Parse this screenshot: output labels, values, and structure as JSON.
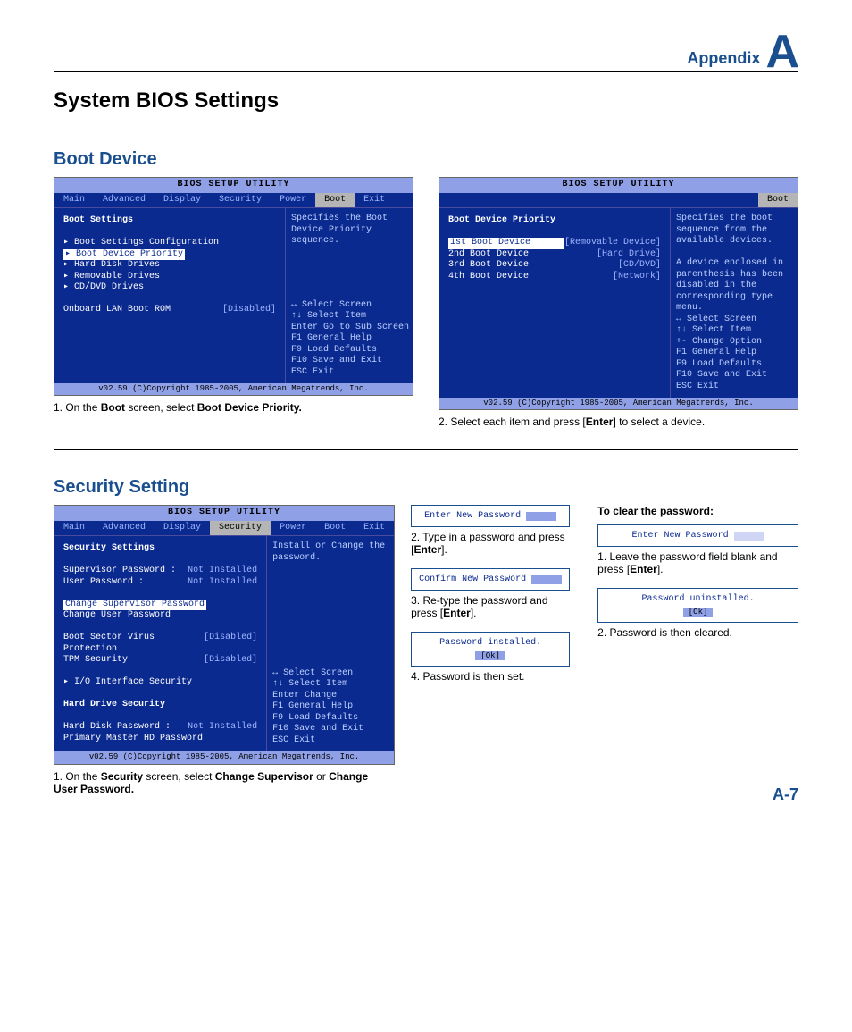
{
  "header": {
    "appendix": "Appendix",
    "letter": "A"
  },
  "title": "System BIOS Settings",
  "page_num": "A-7",
  "bios_common": {
    "util_title": "BIOS SETUP UTILITY",
    "footer": "v02.59 (C)Copyright 1985-2005, American Megatrends, Inc.",
    "tabs": [
      "Main",
      "Advanced",
      "Display",
      "Security",
      "Power",
      "Boot",
      "Exit"
    ],
    "keys_full": [
      "↔    Select Screen",
      "↑↓   Select Item",
      "Enter Go to Sub Screen",
      "F1   General Help",
      "F9   Load Defaults",
      "F10  Save and Exit",
      "ESC  Exit"
    ],
    "keys_sel": [
      "↔    Select Screen",
      "↑↓   Select Item",
      "+-   Change Option",
      "F1   General Help",
      "F9   Load Defaults",
      "F10  Save and Exit",
      "ESC  Exit"
    ],
    "keys_sec": [
      "↔    Select Screen",
      "↑↓   Select Item",
      "Enter Change",
      "F1   General Help",
      "F9   Load Defaults",
      "F10  Save and Exit",
      "ESC  Exit"
    ]
  },
  "boot": {
    "heading": "Boot Device",
    "s1": {
      "help": "Specifies the Boot Device Priority sequence.",
      "sect": "Boot Settings",
      "rows": [
        "▸ Boot Settings Configuration",
        "",
        "▸ Boot Device Priority",
        "▸ Hard Disk Drives",
        "▸ Removable Drives",
        "▸ CD/DVD Drives"
      ],
      "opt_label": "Onboard LAN Boot ROM",
      "opt_val": "[Disabled]",
      "selected_tab": "Boot",
      "caption_pre": "1. On the ",
      "caption_b1": "Boot",
      "caption_mid": " screen, select ",
      "caption_b2": "Boot Device Priority."
    },
    "s2": {
      "help": "Specifies the boot sequence from the available devices.",
      "help2": "A device enclosed in parenthesis has been disabled in the corresponding type menu.",
      "sect": "Boot Device Priority",
      "rows": [
        {
          "l": "1st Boot Device",
          "v": "[Removable Device]"
        },
        {
          "l": "2nd Boot Device",
          "v": "[Hard Drive]"
        },
        {
          "l": "3rd Boot Device",
          "v": "[CD/DVD]"
        },
        {
          "l": "4th Boot Device",
          "v": "[Network]"
        }
      ],
      "selected_tab": "Boot",
      "caption_pre": "2. Select each item and press [",
      "caption_b": "Enter",
      "caption_post": "] to select a device."
    }
  },
  "security": {
    "heading": "Security Setting",
    "bios": {
      "help": "Install or Change the password.",
      "sect": "Security Settings",
      "sup_lbl": "Supervisor Password :",
      "sup_val": "Not Installed",
      "usr_lbl": "User Password      :",
      "usr_val": "Not Installed",
      "c1": "Change Supervisor Password",
      "c2": "Change User Password",
      "bsv_lbl": "Boot Sector Virus Protection",
      "bsv_val": "[Disabled]",
      "tpm_lbl": "TPM Security",
      "tpm_val": "[Disabled]",
      "io": "▸ I/O Interface Security",
      "hd_sect": "Hard Drive Security",
      "hdp_lbl": "Hard Disk Password  :",
      "hdp_val": "Not Installed",
      "pmp": "Primary Master HD Password",
      "selected_tab": "Security",
      "cap_pre": "1. On the ",
      "cap_b1": "Security",
      "cap_mid": " screen, select ",
      "cap_b2": "Change Supervisor",
      "cap_or": " or ",
      "cap_b3": "Change User Password."
    },
    "mid": {
      "p1": "Enter New Password",
      "s2a": "2. Type in a password and press [",
      "s2b": "Enter",
      "s2c": "].",
      "p2": "Confirm New Password",
      "s3a": "3. Re-type the password and press [",
      "s3b": "Enter",
      "s3c": "].",
      "p3": "Password installed.",
      "ok": "[Ok]",
      "s4": "4. Password is then set."
    },
    "right": {
      "head": "To clear the password:",
      "p1": "Enter New Password",
      "s1a": "1. Leave the password field blank and press [",
      "s1b": "Enter",
      "s1c": "].",
      "p2": "Password uninstalled.",
      "ok": "[Ok]",
      "s2": "2. Password is then cleared."
    }
  }
}
